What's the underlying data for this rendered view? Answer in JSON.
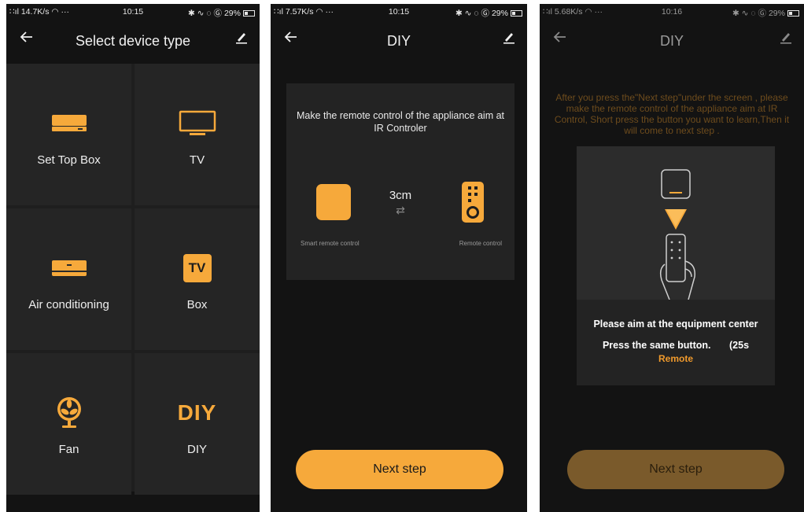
{
  "screens": [
    {
      "status": {
        "left": "∷ıl 14.7K/s ◠ ···",
        "time": "10:15",
        "right": "✱ ∿ ◌ Ⓖ 29%"
      },
      "title": "Select device type",
      "devices": [
        {
          "label": "Set Top Box",
          "icon": "set-top-box-icon"
        },
        {
          "label": "TV",
          "icon": "tv-icon"
        },
        {
          "label": "Air conditioning",
          "icon": "air-conditioner-icon"
        },
        {
          "label": "Box",
          "icon": "tv-box-icon",
          "icon_text": "TV"
        },
        {
          "label": "Fan",
          "icon": "fan-icon"
        },
        {
          "label": "DIY",
          "icon": "diy-icon",
          "icon_text": "DIY"
        }
      ]
    },
    {
      "status": {
        "left": "∷ıl 7.57K/s ◠ ···",
        "time": "10:15",
        "right": "✱ ∿ ◌ Ⓖ 29%"
      },
      "title": "DIY",
      "instruction": "Make the remote control of the appliance aim at IR Controler",
      "distance": "3cm",
      "arrows": "⇄",
      "left_caption": "Smart remote control",
      "right_caption": "Remote control",
      "next_label": "Next step"
    },
    {
      "status": {
        "left": "∷ıl 5.68K/s ◠ ···",
        "time": "10:16",
        "right": "✱ ∿ ◌ Ⓖ 29%"
      },
      "title": "DIY",
      "instruction": "After you press the\"Next step\"under the screen , please make the remote control of the appliance aim at IR Control, Short press the button you want to learn,Then it  will come to next step .",
      "aim_text": "Please aim at the equipment center",
      "press_text": "Press the same button.",
      "countdown": "(25s",
      "remote_text": "Remote",
      "next_label": "Next step"
    }
  ],
  "colors": {
    "accent": "#f6a93b",
    "background": "#131313",
    "cell": "#252525",
    "disabled_button": "#7a5a2b"
  }
}
